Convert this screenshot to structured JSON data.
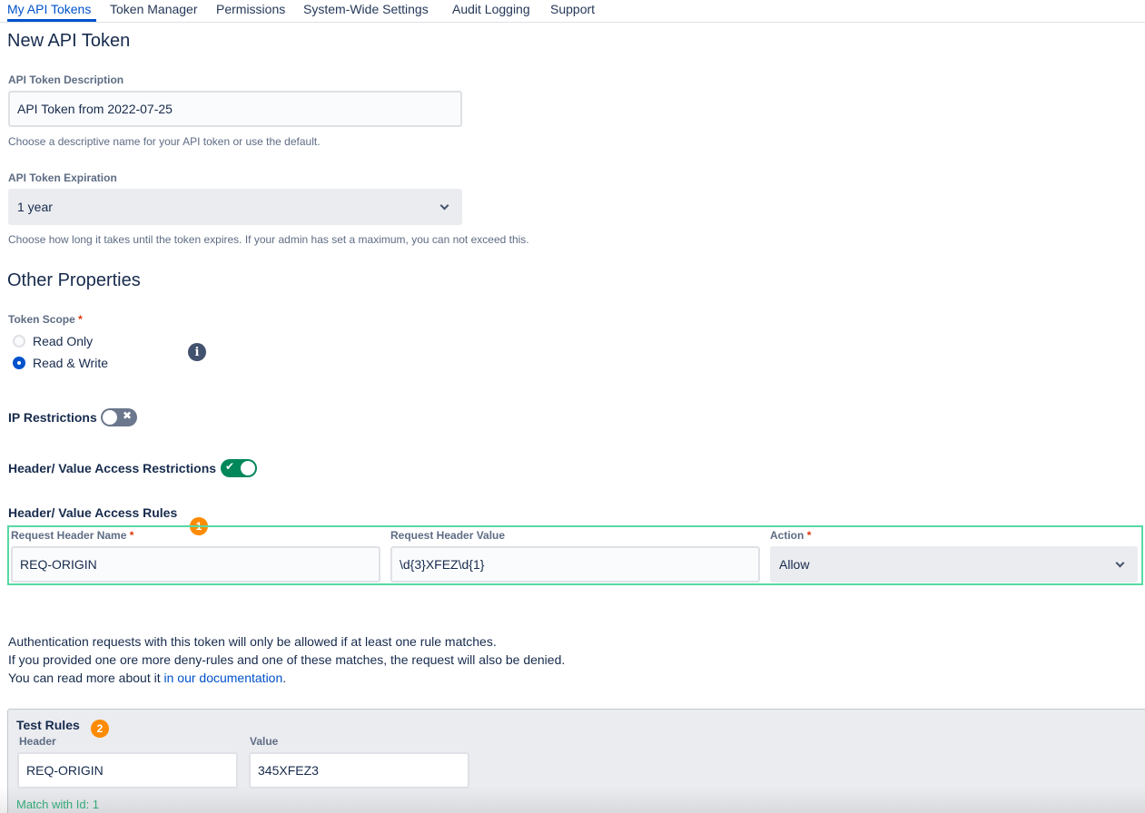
{
  "nav": {
    "tabs": [
      {
        "label": "My API Tokens",
        "active": true
      },
      {
        "label": "Token Manager"
      },
      {
        "label": "Permissions"
      },
      {
        "label": "System-Wide Settings"
      },
      {
        "label": "Audit Logging"
      },
      {
        "label": "Support"
      }
    ]
  },
  "form": {
    "title": "New API Token",
    "description": {
      "label": "API Token Description",
      "value": "API Token from 2022-07-25",
      "help": "Choose a descriptive name for your API token or use the default."
    },
    "expiration": {
      "label": "API Token Expiration",
      "value": "1 year",
      "help": "Choose how long it takes until the token expires. If your admin has set a maximum, you can not exceed this."
    }
  },
  "other": {
    "title": "Other Properties",
    "scope": {
      "label": "Token Scope",
      "required": "*",
      "options": [
        {
          "label": "Read Only",
          "checked": false
        },
        {
          "label": "Read & Write",
          "checked": true
        }
      ],
      "info_icon": "i"
    },
    "ip_restrictions": {
      "label": "IP Restrictions",
      "enabled": false,
      "glyph": "✖"
    },
    "header_restrictions": {
      "label": "Header/ Value Access Restrictions",
      "enabled": true,
      "glyph": "✔"
    }
  },
  "rules": {
    "title": "Header/ Value Access Rules",
    "badge": "1",
    "name_label": "Request Header Name",
    "value_label": "Request Header Value",
    "action_label": "Action",
    "required": "*",
    "row": {
      "name": "REQ-ORIGIN",
      "value": "\\d{3}XFEZ\\d{1}",
      "action": "Allow"
    }
  },
  "notes": {
    "line1": "Authentication requests with this token will only be allowed if at least one rule matches.",
    "line2": "If you provided one ore more deny-rules and one of these matches, the request will also be denied.",
    "line3_prefix": "You can read more about it ",
    "line3_link": "in our documentation",
    "line3_suffix": "."
  },
  "test": {
    "title": "Test Rules",
    "badge": "2",
    "header_label": "Header",
    "value_label": "Value",
    "header_value": "REQ-ORIGIN",
    "value_value": "345XFEZ3",
    "result": "Match with Id: 1"
  },
  "colors": {
    "primary": "#0052cc",
    "success": "#00875a",
    "highlight_border": "#57d9a3",
    "badge": "#ff8b00",
    "required": "#de350b"
  }
}
